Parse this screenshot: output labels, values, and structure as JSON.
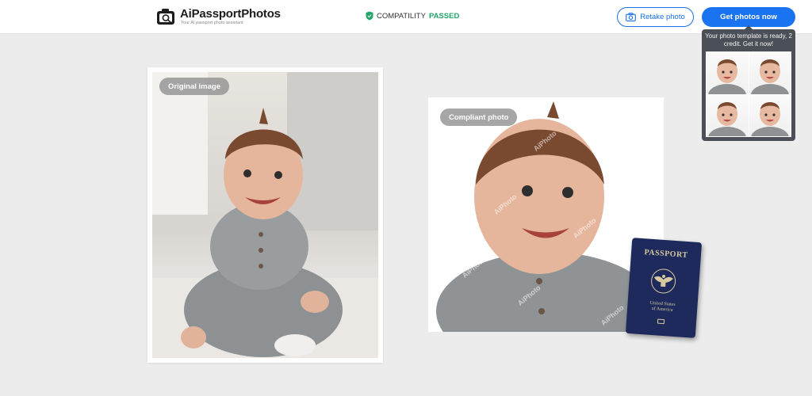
{
  "header": {
    "logo_title": "AiPassportPhotos",
    "logo_subtitle": "Your AI passport photo assistant",
    "compat_label": "COMPATILITY",
    "compat_status": "PASSED",
    "retake_label": "Retake photo",
    "get_photos_label": "Get photos now"
  },
  "popup": {
    "text": "Your photo template is ready, 2 credit. Get it now!"
  },
  "photos": {
    "original_label": "Original image",
    "compliant_label": "Compliant photo",
    "watermark": "AiPhoto"
  },
  "passport": {
    "title": "PASSPORT",
    "country_line1": "United States",
    "country_line2": "of America"
  },
  "colors": {
    "accent": "#1a73f0",
    "passed": "#22a567",
    "popup_bg": "#4b4f58",
    "passport": "#1e2a5c"
  }
}
